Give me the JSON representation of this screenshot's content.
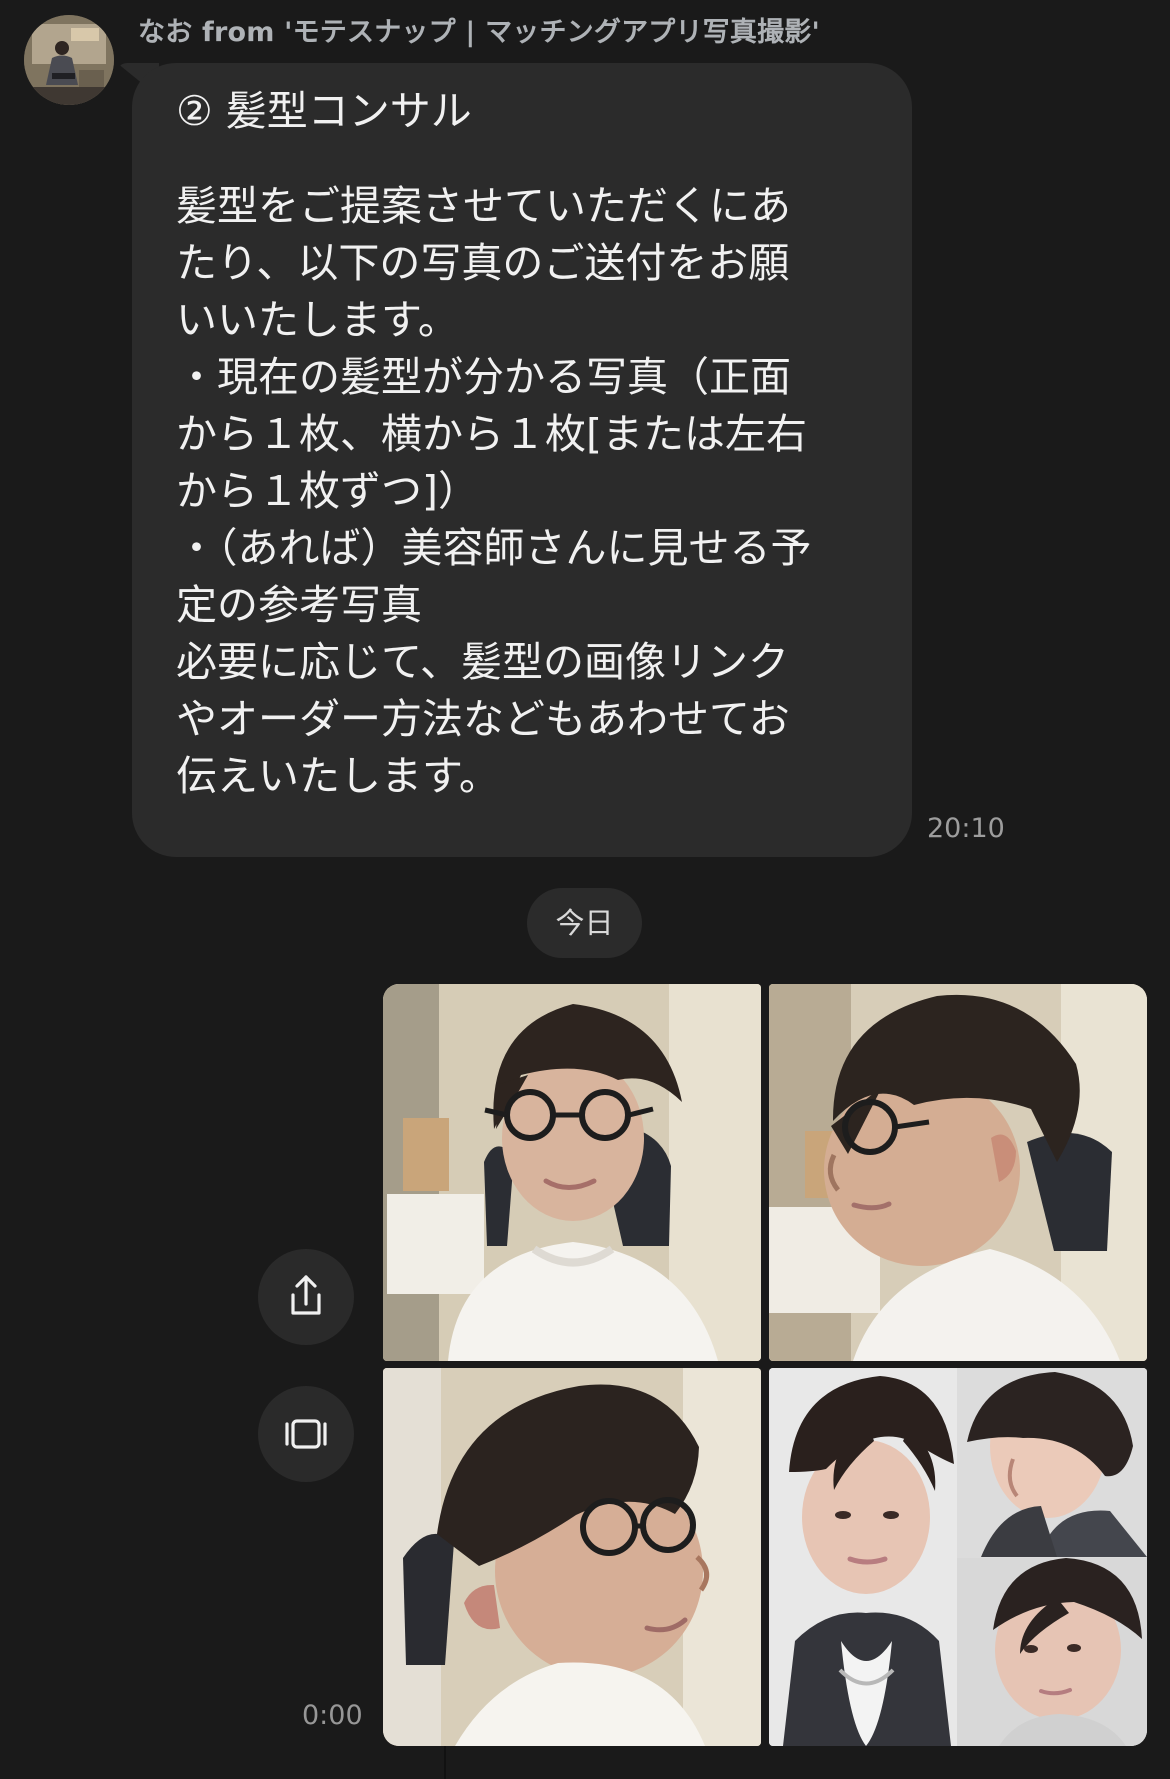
{
  "chat": {
    "sender_name": "なお from 'モテスナップ | マッチングアプリ写真撮影'",
    "message": {
      "title": "② 髪型コンサル",
      "body": "髪型をご提案させていただくにあ\nたり、以下の写真のご送付をお願\nいいたします。\n・現在の髪型が分かる写真（正面\nから１枚、横から１枚[または左右\nから１枚ずつ]）\n・（あれば）美容師さんに見せる予\n定の参考写真\n必要に応じて、髪型の画像リンク\nやオーダー方法などもあわせてお\n伝えいたします。",
      "time": "20:10"
    },
    "day_separator": "今日",
    "attachment_time": "0:00"
  },
  "icons": {
    "avatar": "user-avatar-icon",
    "share": "share-icon",
    "carousel": "carousel-icon"
  },
  "colors": {
    "background": "#1a1a1a",
    "bubble": "#2b2b2b",
    "text": "#f1f1f1",
    "muted_text": "#9d9d9d"
  }
}
